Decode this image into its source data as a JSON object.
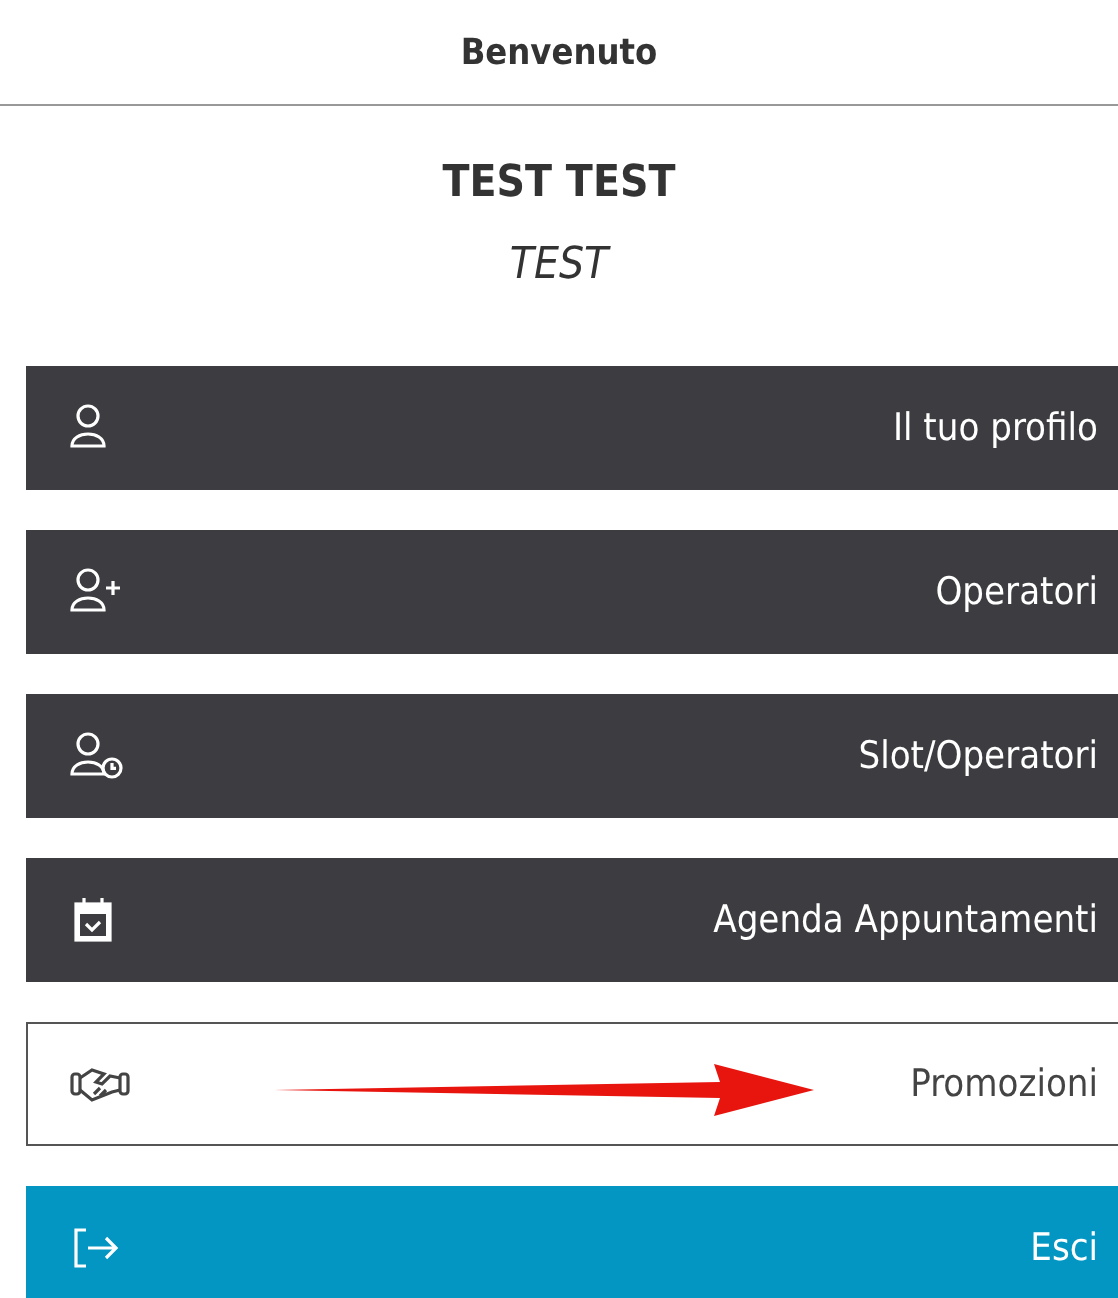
{
  "header": {
    "title": "Benvenuto"
  },
  "user": {
    "name": "TEST TEST",
    "role": "TEST"
  },
  "menu": [
    {
      "label": "Il tuo profilo",
      "kind": "dark"
    },
    {
      "label": "Operatori",
      "kind": "dark"
    },
    {
      "label": "Slot/Operatori",
      "kind": "dark"
    },
    {
      "label": "Agenda Appuntamenti",
      "kind": "dark"
    },
    {
      "label": "Promozioni",
      "kind": "outline"
    },
    {
      "label": "Esci",
      "kind": "primary"
    }
  ]
}
